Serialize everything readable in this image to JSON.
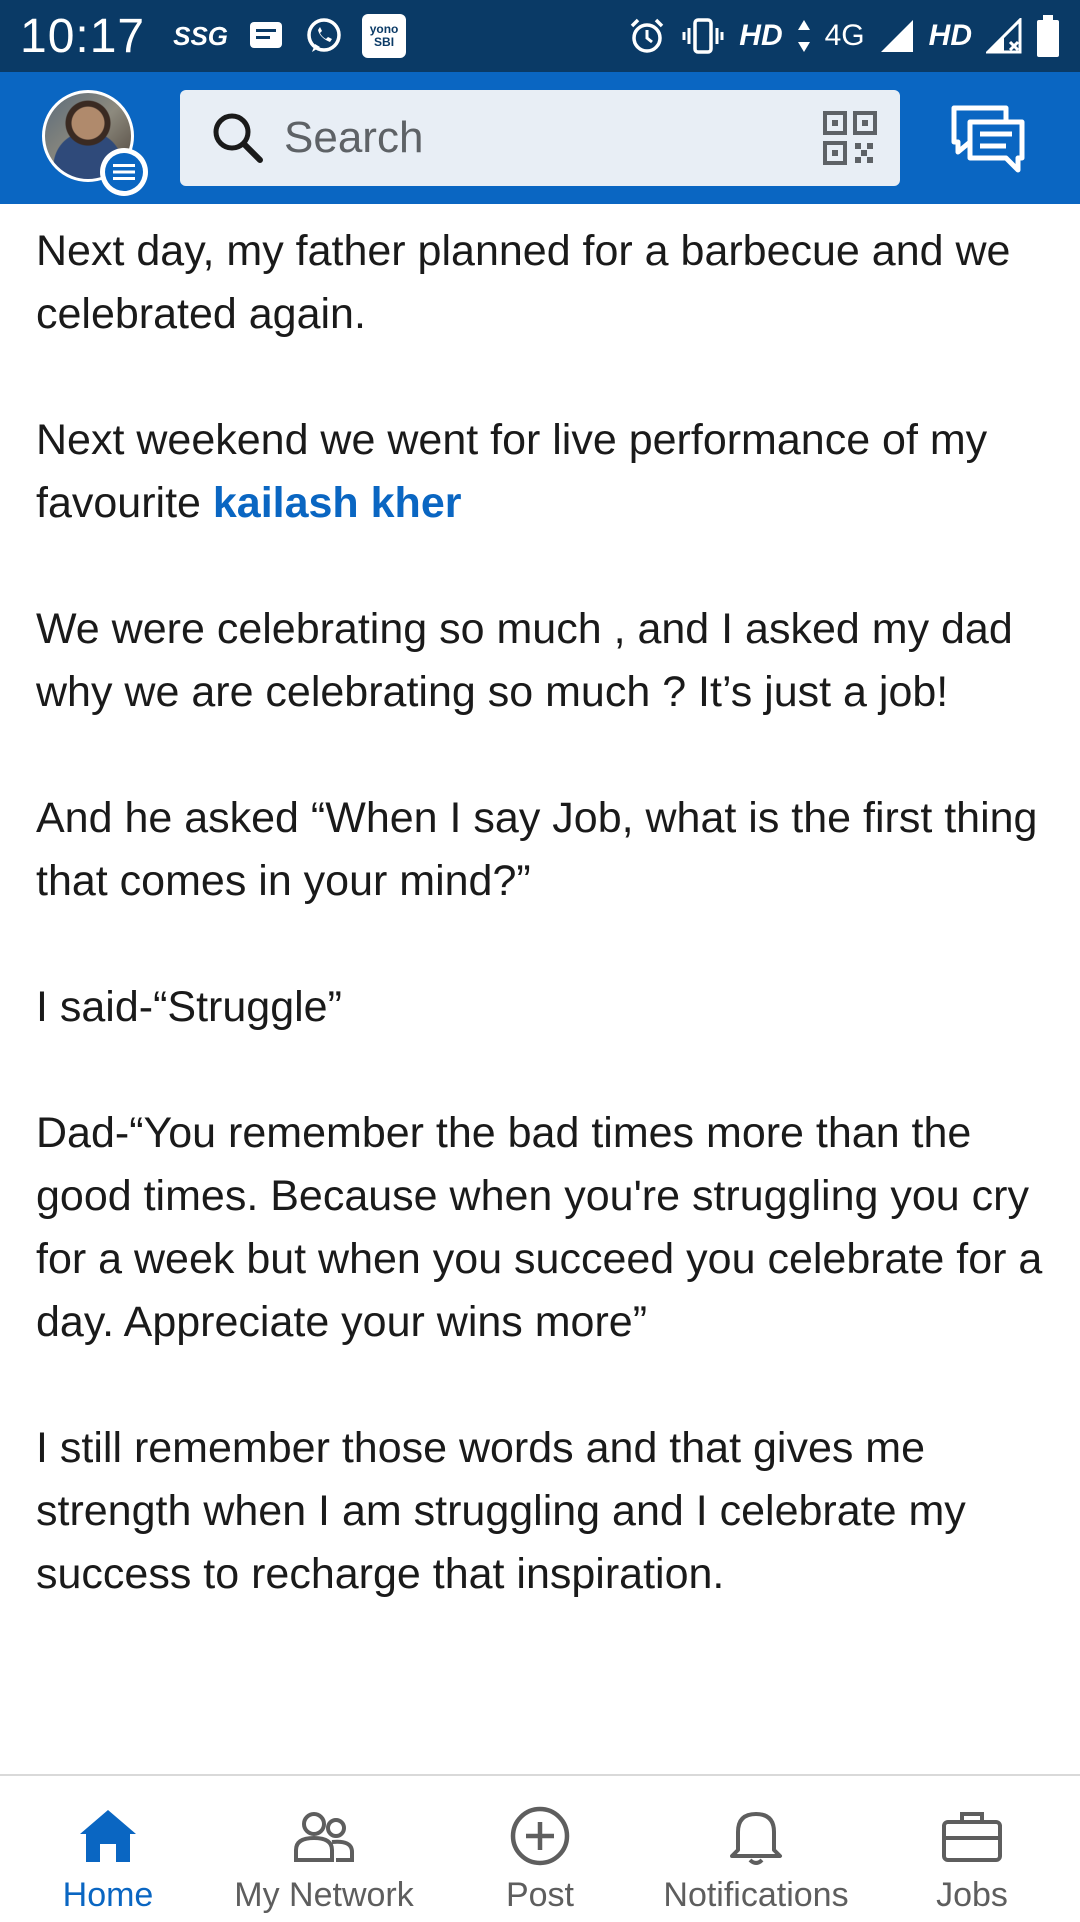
{
  "status_bar": {
    "time": "10:17",
    "left_badge": "SSG",
    "yono_line1": "yono",
    "yono_line2": "SBI",
    "hd1": "HD",
    "network": "4G",
    "hd2": "HD"
  },
  "header": {
    "search_placeholder": "Search"
  },
  "post": {
    "p1": "Next day, my father planned for a barbecue and we celebrated again.",
    "p2_prefix": "Next weekend we went for live performance of my favourite ",
    "p2_mention": "kailash kher",
    "p3": "We were celebrating so much , and I asked my dad why we are celebrating so much ? It’s just a job!",
    "p4": "And he asked “When I say Job, what is the first thing that comes in your mind?”",
    "p5": "I said-“Struggle”",
    "p6": "Dad-“You remember the bad times more than the good times. Because when you're struggling you cry for a week but when you succeed you celebrate for a day. Appreciate your wins more”",
    "p7": "I still remember those words and that gives me strength when I am struggling and I celebrate my success to recharge that inspiration."
  },
  "bottom_nav": {
    "items": [
      {
        "label": "Home",
        "icon": "home-icon",
        "active": true
      },
      {
        "label": "My Network",
        "icon": "network-icon",
        "active": false
      },
      {
        "label": "Post",
        "icon": "post-plus-icon",
        "active": false
      },
      {
        "label": "Notifications",
        "icon": "bell-icon",
        "active": false
      },
      {
        "label": "Jobs",
        "icon": "briefcase-icon",
        "active": false
      }
    ]
  },
  "colors": {
    "brand": "#0a66c2",
    "status_bar": "#0a3a66",
    "text": "#1a1a1a",
    "nav_inactive": "#5e5e5e"
  }
}
